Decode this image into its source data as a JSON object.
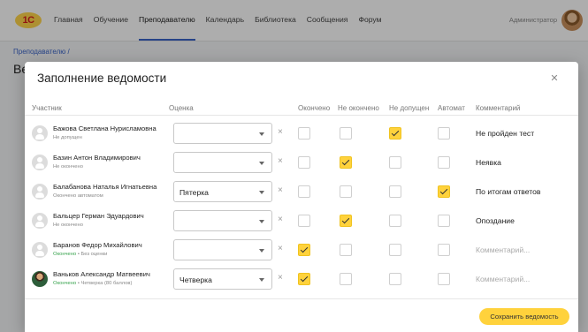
{
  "nav": {
    "logo": "1С",
    "items": [
      "Главная",
      "Обучение",
      "Преподавателю",
      "Календарь",
      "Библиотека",
      "Сообщения",
      "Форум"
    ],
    "active": "Преподавателю",
    "user": "Администратор"
  },
  "background": {
    "breadcrumb": "Преподавателю  /",
    "title": "Ве"
  },
  "modal": {
    "title": "Заполнение ведомости",
    "close_icon": "close-icon",
    "columns": {
      "participant": "Участник",
      "grade": "Оценка",
      "done": "Окончено",
      "not_done": "Не окончено",
      "not_allowed": "Не допущен",
      "auto": "Автомат",
      "comment": "Комментарий"
    },
    "comment_placeholder": "Комментарий...",
    "rows": [
      {
        "name": "Бажова Светлана Нурисламовна",
        "status": "Не допущен",
        "status_ok": "",
        "status_extra": "",
        "grade": "",
        "done": false,
        "not_done": false,
        "not_allowed": true,
        "auto": false,
        "comment": "Не пройден тест",
        "photo": false
      },
      {
        "name": "Базин Антон Владимирович",
        "status": "Не окончено",
        "status_ok": "",
        "status_extra": "",
        "grade": "",
        "done": false,
        "not_done": true,
        "not_allowed": false,
        "auto": false,
        "comment": "Неявка",
        "photo": false
      },
      {
        "name": "Балабанова Наталья Игнатьевна",
        "status": "Окончено автоматом",
        "status_ok": "",
        "status_extra": "",
        "grade": "Пятерка",
        "done": false,
        "not_done": false,
        "not_allowed": false,
        "auto": true,
        "comment": "По итогам ответов",
        "photo": false
      },
      {
        "name": "Бальцер Герман Эдуардович",
        "status": "Не окончено",
        "status_ok": "",
        "status_extra": "",
        "grade": "",
        "done": false,
        "not_done": true,
        "not_allowed": false,
        "auto": false,
        "comment": "Опоздание",
        "photo": false
      },
      {
        "name": "Баранов Федор Михайлович",
        "status": "",
        "status_ok": "Окончено",
        "status_extra": " • Без оценки",
        "grade": "",
        "done": true,
        "not_done": false,
        "not_allowed": false,
        "auto": false,
        "comment": "",
        "photo": false
      },
      {
        "name": "Ваньков Александр Матвеевич",
        "status": "",
        "status_ok": "Окончено",
        "status_extra": " • Четверка (80 баллов)",
        "grade": "Четверка",
        "done": true,
        "not_done": false,
        "not_allowed": false,
        "auto": false,
        "comment": "",
        "photo": true
      }
    ],
    "save_label": "Сохранить ведомость"
  },
  "colors": {
    "accent": "#ffd23c",
    "link": "#3a64c8",
    "ok_status": "#37a34d"
  }
}
